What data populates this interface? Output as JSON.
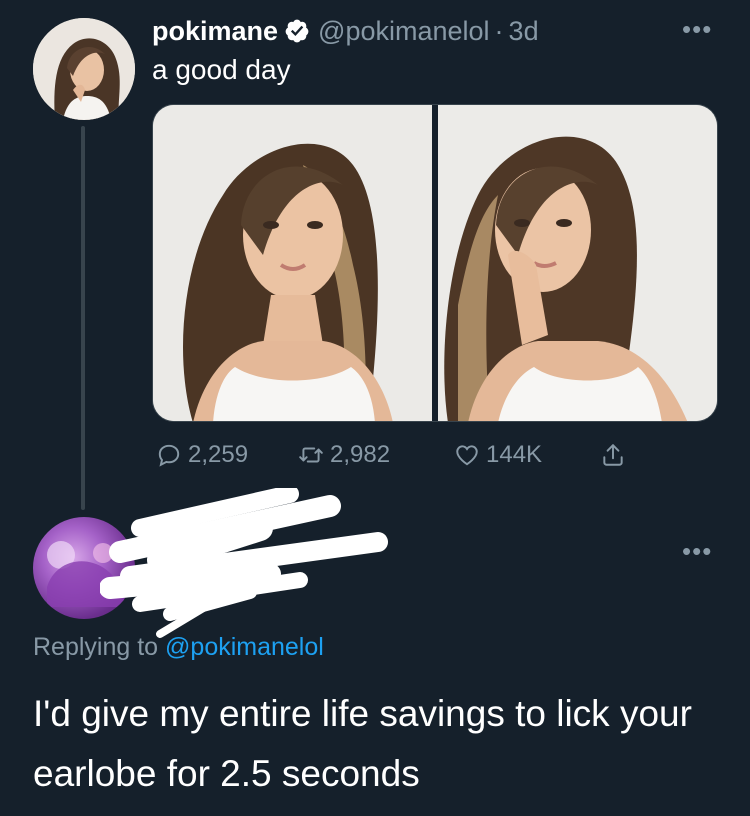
{
  "tweet": {
    "author_name": "pokimane",
    "author_handle": "@pokimanelol",
    "separator": "·",
    "time": "3d",
    "more_label": "•••",
    "text": "a good day",
    "stats": {
      "replies": "2,259",
      "retweets": "2,982",
      "likes": "144K"
    }
  },
  "reply": {
    "more_label": "•••",
    "replying_prefix": "Replying to ",
    "replying_to": "@pokimanelol",
    "text": "I'd give my entire life savings to lick your earlobe for 2.5 seconds"
  },
  "colors": {
    "background": "#15202b",
    "secondary_text": "#8899a6",
    "link": "#1da1f2",
    "verified": "#ffffff"
  }
}
